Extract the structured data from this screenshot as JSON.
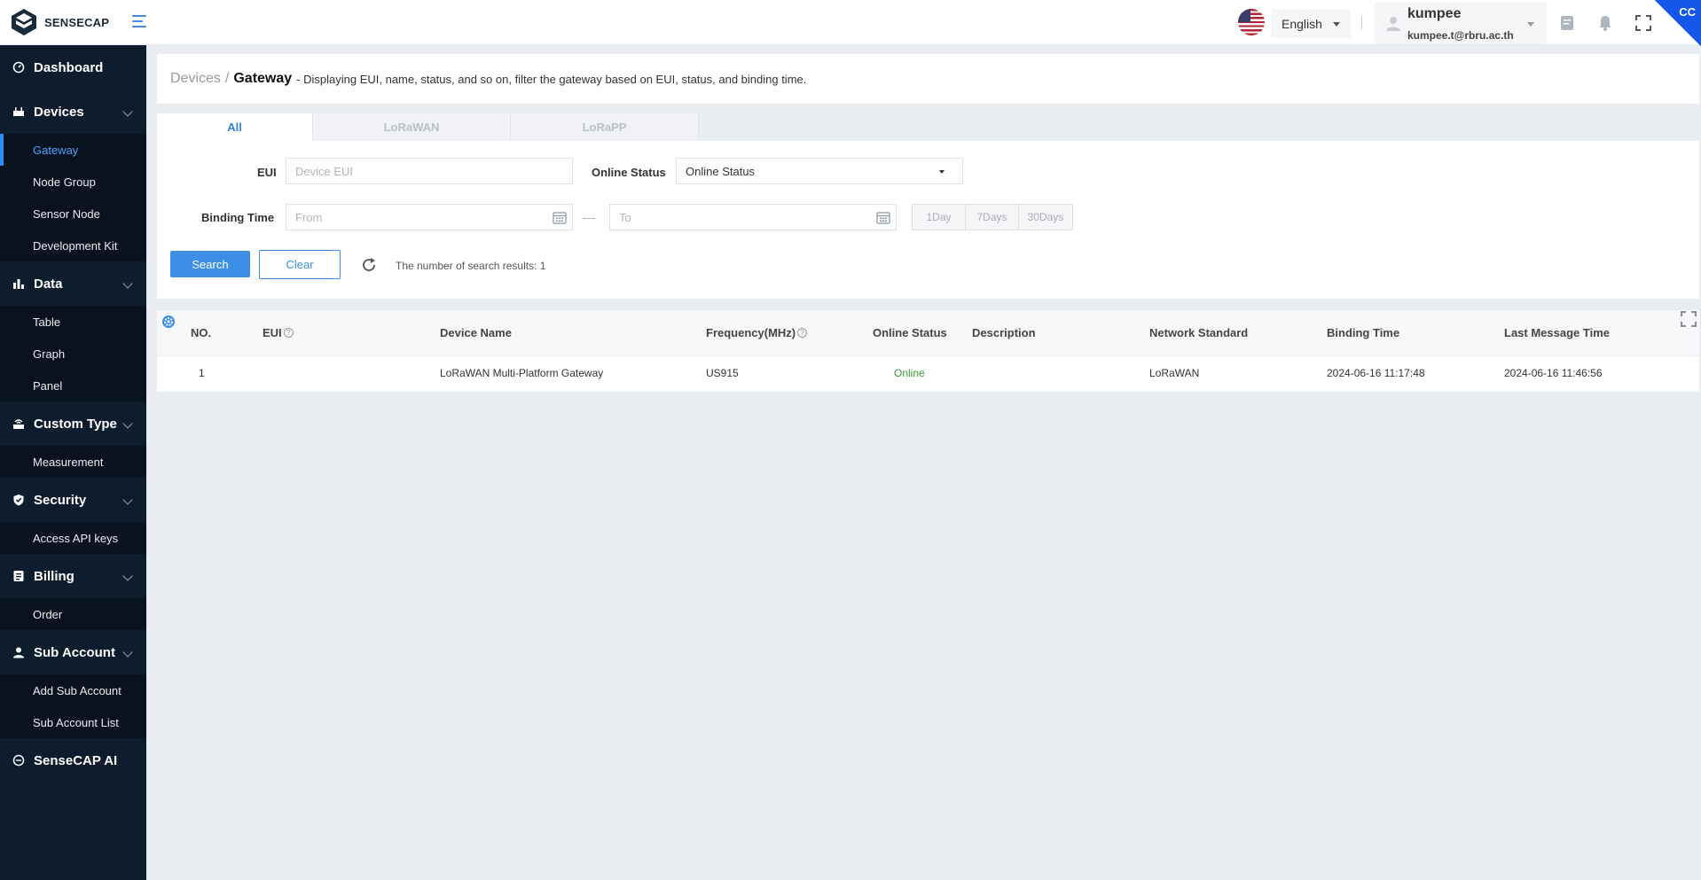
{
  "app": {
    "brand": "SENSECAP",
    "corner_badge": "CC"
  },
  "header": {
    "language": "English",
    "user_name": "kumpee",
    "user_email": "kumpee.t@rbru.ac.th"
  },
  "sidebar": {
    "dashboard": "Dashboard",
    "devices": {
      "label": "Devices",
      "items": [
        "Gateway",
        "Node Group",
        "Sensor Node",
        "Development Kit"
      ]
    },
    "data": {
      "label": "Data",
      "items": [
        "Table",
        "Graph",
        "Panel"
      ]
    },
    "custom_type": {
      "label": "Custom Type",
      "items": [
        "Measurement"
      ]
    },
    "security": {
      "label": "Security",
      "items": [
        "Access API keys"
      ]
    },
    "billing": {
      "label": "Billing",
      "items": [
        "Order"
      ]
    },
    "sub_account": {
      "label": "Sub Account",
      "items": [
        "Add Sub Account",
        "Sub Account List"
      ]
    },
    "sensecap_ai": "SenseCAP AI",
    "active_item": "Gateway"
  },
  "breadcrumb": {
    "parent": "Devices",
    "separator": "/",
    "current": "Gateway",
    "description": "- Displaying EUI, name, status, and so on, filter the gateway based on EUI, status, and binding time."
  },
  "tabs": [
    "All",
    "LoRaWAN",
    "LoRaPP"
  ],
  "filters": {
    "eui_label": "EUI",
    "eui_placeholder": "Device EUI",
    "online_status_label": "Online Status",
    "online_status_value": "Online Status",
    "binding_time_label": "Binding Time",
    "from_placeholder": "From",
    "to_placeholder": "To",
    "range_separator": "—",
    "quick_ranges": [
      "1Day",
      "7Days",
      "30Days"
    ],
    "search_button": "Search",
    "clear_button": "Clear",
    "result_text": "The number of search results: 1"
  },
  "table": {
    "columns": [
      "NO.",
      "EUI",
      "Device Name",
      "Frequency(MHz)",
      "Online Status",
      "Description",
      "Network Standard",
      "Binding Time",
      "Last Message Time"
    ],
    "help_mark": "?",
    "rows": [
      {
        "no": "1",
        "eui": "",
        "device_name": "LoRaWAN Multi-Platform Gateway",
        "frequency": "US915",
        "online_status": "Online",
        "description": "",
        "network_standard": "LoRaWAN",
        "binding_time": "2024-06-16 11:17:48",
        "last_message_time": "2024-06-16 11:46:56"
      }
    ]
  },
  "colors": {
    "sidebar_bg": "#0e1d2e",
    "accent": "#3d8fe6",
    "online": "#3a9a3a"
  }
}
